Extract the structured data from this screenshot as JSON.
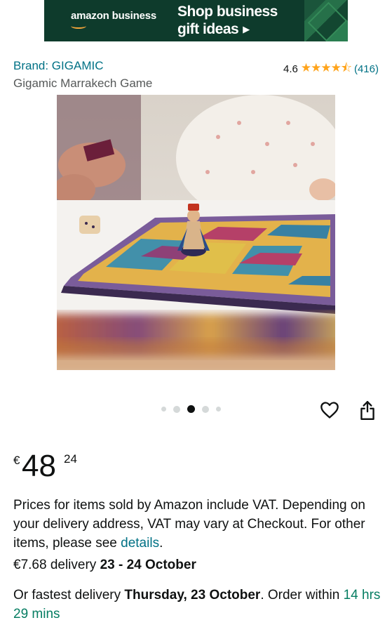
{
  "banner": {
    "logo": "amazon business",
    "headline_line1": "Shop business",
    "headline_line2": "gift ideas",
    "arrow_icon": "play-arrow-icon"
  },
  "product": {
    "brand": "Brand: GIGAMIC",
    "title": "Gigamic Marrakech Game",
    "rating_value": "4.6",
    "rating_stars": 4.6,
    "rating_count": "(416)",
    "image_alt": "Marrakech board game being played on a table"
  },
  "carousel": {
    "total": 5,
    "active_index": 2
  },
  "actions": {
    "wishlist_icon": "heart-icon",
    "share_icon": "share-icon"
  },
  "price": {
    "currency": "€",
    "whole": "48",
    "fraction": "24"
  },
  "vat": {
    "text": "Prices for items sold by Amazon include VAT. Depending on your delivery address, VAT may vary at Checkout. For other items, please see ",
    "link": "details",
    "end": "."
  },
  "delivery": {
    "cost": "€7.68 delivery ",
    "dates": "23 - 24 October"
  },
  "fastest": {
    "prefix": "Or fastest delivery ",
    "date": "Thursday, 23 October",
    "middle": ". Order within ",
    "countdown": "14 hrs 29 mins"
  },
  "colors": {
    "link": "#007185",
    "star": "#ffa41c",
    "countdown": "#067d62",
    "banner_bg": "#0e3b2c"
  }
}
